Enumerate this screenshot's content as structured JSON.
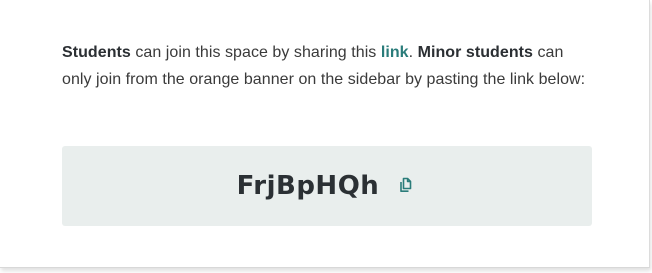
{
  "invite": {
    "students_label": "Students",
    "text_1": " can join this space by sharing this ",
    "link_label": "link",
    "text_2": ". ",
    "minor_label": "Minor students",
    "text_3": " can only join from the orange banner on the sidebar by pasting the link below:"
  },
  "code": {
    "value": "FrjBpHQh",
    "copy_icon": "copy-icon"
  },
  "colors": {
    "accent": "#2a7c7a",
    "box_background": "#e9eeed",
    "text": "#3a3a3a"
  }
}
